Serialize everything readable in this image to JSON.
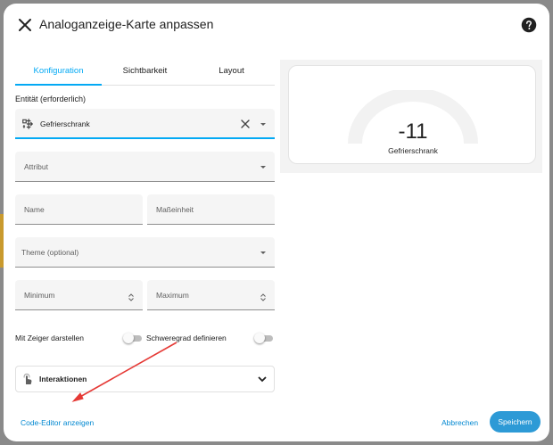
{
  "dialog": {
    "title": "Analoganzeige-Karte anpassen"
  },
  "tabs": [
    {
      "label": "Konfiguration",
      "active": true
    },
    {
      "label": "Sichtbarkeit",
      "active": false
    },
    {
      "label": "Layout",
      "active": false
    }
  ],
  "form": {
    "entity_label": "Entität (erforderlich)",
    "entity_value": "Gefrierschrank",
    "attribute_placeholder": "Attribut",
    "name_placeholder": "Name",
    "unit_placeholder": "Maßeinheit",
    "theme_placeholder": "Theme (optional)",
    "minimum_placeholder": "Minimum",
    "maximum_placeholder": "Maximum",
    "needle_toggle_label": "Mit Zeiger darstellen",
    "needle_toggle_on": false,
    "severity_toggle_label": "Schweregrad definieren",
    "severity_toggle_on": false,
    "interactions_label": "Interaktionen"
  },
  "footer": {
    "code_editor_label": "Code-Editor anzeigen",
    "cancel_label": "Abbrechen",
    "save_label": "Speichern"
  },
  "preview": {
    "value": "-11",
    "name": "Gefrierschrank"
  },
  "colors": {
    "accent": "#03a9f4",
    "save_button": "#2d9ad6",
    "annotation_arrow": "#e53935"
  },
  "icons": [
    "close-icon",
    "help-icon",
    "entity-device-icon",
    "clear-icon",
    "chevron-down-icon",
    "touch-icon"
  ]
}
